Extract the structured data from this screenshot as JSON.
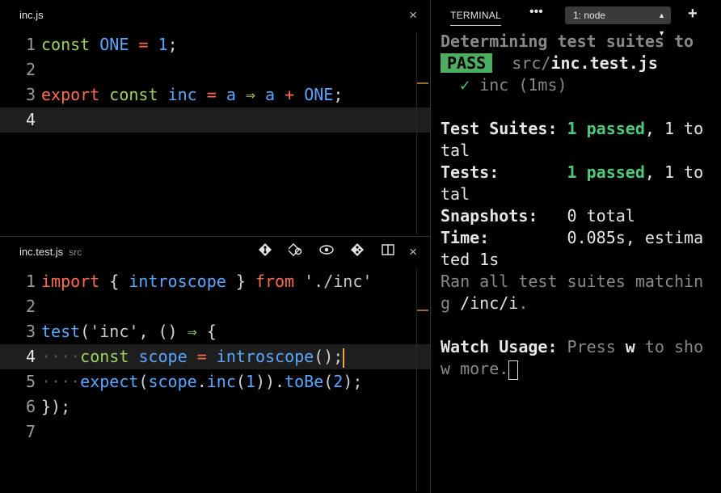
{
  "editor_top": {
    "tab": "inc.js",
    "close": "×",
    "lines": [
      {
        "n": "1",
        "tokens": [
          [
            "const",
            "ty"
          ],
          [
            " ",
            ""
          ],
          [
            "ONE",
            "id"
          ],
          [
            " ",
            ""
          ],
          [
            "=",
            "op"
          ],
          [
            " ",
            ""
          ],
          [
            "1",
            "nm"
          ],
          [
            ";",
            ""
          ]
        ]
      },
      {
        "n": "2",
        "tokens": []
      },
      {
        "n": "3",
        "tokens": [
          [
            "export",
            "kw"
          ],
          [
            " ",
            ""
          ],
          [
            "const",
            "ty"
          ],
          [
            " ",
            ""
          ],
          [
            "inc",
            "id"
          ],
          [
            " ",
            ""
          ],
          [
            "=",
            "op"
          ],
          [
            " ",
            ""
          ],
          [
            "a",
            "id"
          ],
          [
            " ",
            ""
          ],
          [
            "⇒",
            "ty"
          ],
          [
            " ",
            ""
          ],
          [
            "a",
            "id"
          ],
          [
            " ",
            ""
          ],
          [
            "+",
            "op"
          ],
          [
            " ",
            ""
          ],
          [
            "ONE",
            "id"
          ],
          [
            ";",
            ""
          ]
        ]
      },
      {
        "n": "4",
        "tokens": [],
        "current": true
      }
    ]
  },
  "editor_bottom": {
    "tab": "inc.test.js",
    "tab_dir": "src",
    "close": "×",
    "toolbar_icons": [
      "git-compare-icon",
      "open-changes-icon",
      "preview-icon",
      "git-branch-icon",
      "split-editor-icon"
    ],
    "lines": [
      {
        "n": "1",
        "tokens": [
          [
            "import",
            "kw"
          ],
          [
            " { ",
            ""
          ],
          [
            "introscope",
            "id"
          ],
          [
            " } ",
            ""
          ],
          [
            "from",
            "kw"
          ],
          [
            " ",
            ""
          ],
          [
            "'./inc'",
            "str"
          ]
        ]
      },
      {
        "n": "2",
        "tokens": []
      },
      {
        "n": "3",
        "tokens": [
          [
            "test",
            "fn"
          ],
          [
            "(",
            ""
          ],
          [
            "'inc'",
            "str"
          ],
          [
            ", () ",
            ""
          ],
          [
            "⇒",
            "ty"
          ],
          [
            " {",
            ""
          ]
        ]
      },
      {
        "n": "4",
        "tokens": [
          [
            "····",
            "dots"
          ],
          [
            "const",
            "ty"
          ],
          [
            " ",
            ""
          ],
          [
            "scope",
            "id"
          ],
          [
            " ",
            ""
          ],
          [
            "=",
            "op"
          ],
          [
            " ",
            ""
          ],
          [
            "introscope",
            "fn"
          ],
          [
            "();",
            ""
          ]
        ],
        "current": true,
        "cursor": true
      },
      {
        "n": "5",
        "tokens": [
          [
            "····",
            "dots"
          ],
          [
            "expect",
            "fn"
          ],
          [
            "(",
            ""
          ],
          [
            "scope",
            "id"
          ],
          [
            ".",
            ""
          ],
          [
            "inc",
            "fn"
          ],
          [
            "(",
            ""
          ],
          [
            "1",
            "nm"
          ],
          [
            ")).",
            ""
          ],
          [
            "toBe",
            "fn"
          ],
          [
            "(",
            ""
          ],
          [
            "2",
            "nm"
          ],
          [
            ");",
            ""
          ]
        ]
      },
      {
        "n": "6",
        "tokens": [
          [
            "});",
            ""
          ]
        ]
      },
      {
        "n": "7",
        "tokens": []
      }
    ]
  },
  "terminal": {
    "title": "TERMINAL",
    "more": "•••",
    "selected_shell": "1: node",
    "plus": "+",
    "lines": [
      [
        [
          "Determining test suites to",
          "b dim"
        ]
      ],
      [
        [
          "PASS",
          "pass"
        ],
        [
          "  src/",
          "dim"
        ],
        [
          "inc.test.js",
          "b"
        ]
      ],
      [
        [
          "  ",
          ""
        ],
        [
          "✓",
          "green"
        ],
        [
          " inc (1ms)",
          "dim"
        ]
      ],
      [
        [
          "",
          ""
        ]
      ],
      [
        [
          "Test Suites: ",
          "b"
        ],
        [
          "1 passed",
          "b green"
        ],
        [
          ", 1 to",
          ""
        ]
      ],
      [
        [
          "tal",
          ""
        ]
      ],
      [
        [
          "Tests:       ",
          "b"
        ],
        [
          "1 passed",
          "b green"
        ],
        [
          ", 1 to",
          ""
        ]
      ],
      [
        [
          "tal",
          ""
        ]
      ],
      [
        [
          "Snapshots:",
          "b"
        ],
        [
          "   0 total",
          ""
        ]
      ],
      [
        [
          "Time:",
          "b"
        ],
        [
          "        0.085s, estima",
          ""
        ]
      ],
      [
        [
          "ted 1s",
          ""
        ]
      ],
      [
        [
          "Ran all test suites matchin",
          "dim"
        ]
      ],
      [
        [
          "g ",
          "dim"
        ],
        [
          "/inc/i",
          ""
        ],
        [
          ".",
          "dim"
        ]
      ],
      [
        [
          "",
          ""
        ]
      ],
      [
        [
          "Watch Usage:",
          "b"
        ],
        [
          " Press ",
          "dim"
        ],
        [
          "w",
          "b"
        ],
        [
          " to sho",
          "dim"
        ]
      ],
      [
        [
          "w more.",
          "dim"
        ],
        [
          "CURSOR",
          "cursor"
        ]
      ]
    ]
  }
}
